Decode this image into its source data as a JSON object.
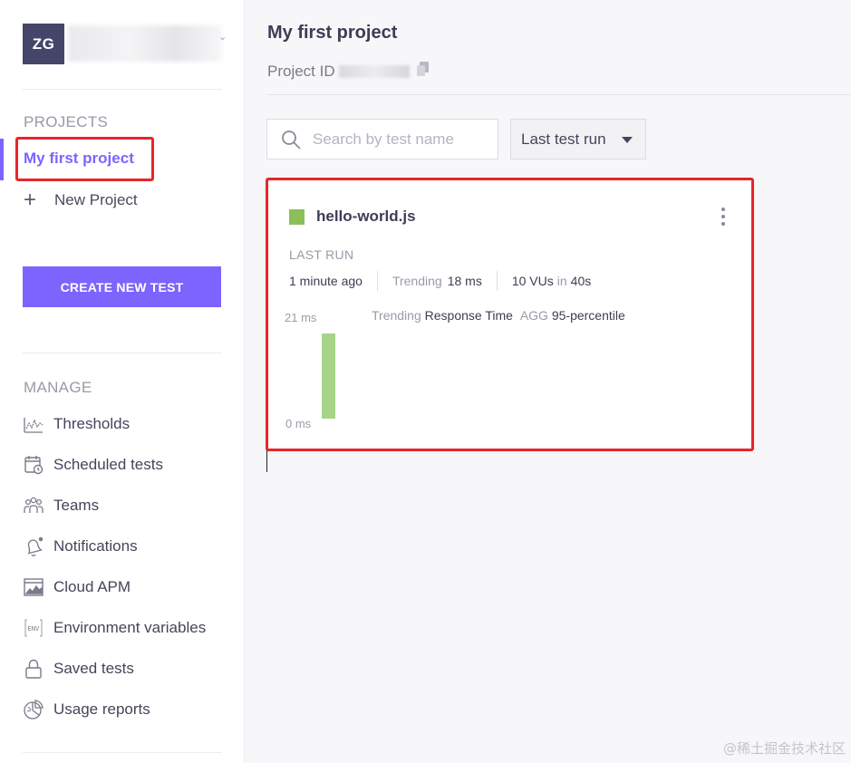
{
  "user": {
    "initials": "ZG"
  },
  "sidebar": {
    "projects_heading": "PROJECTS",
    "active_project": "My first project",
    "new_project_label": "New Project",
    "create_button": "CREATE NEW TEST",
    "manage_heading": "MANAGE",
    "manage_items": [
      {
        "label": "Thresholds",
        "icon": "thresholds-icon"
      },
      {
        "label": "Scheduled tests",
        "icon": "calendar-clock-icon"
      },
      {
        "label": "Teams",
        "icon": "people-icon"
      },
      {
        "label": "Notifications",
        "icon": "bell-icon"
      },
      {
        "label": "Cloud APM",
        "icon": "chart-window-icon"
      },
      {
        "label": "Environment variables",
        "icon": "env-icon"
      },
      {
        "label": "Saved tests",
        "icon": "lock-icon"
      },
      {
        "label": "Usage reports",
        "icon": "pie-chart-icon"
      }
    ]
  },
  "main": {
    "title": "My first project",
    "project_id_label": "Project ID",
    "search_placeholder": "Search by test name",
    "sort_value": "Last test run",
    "test_card": {
      "name": "hello-world.js",
      "status_color": "#8cbf5a",
      "last_run_label": "LAST RUN",
      "last_run_value": "1 minute ago",
      "trending_label": "Trending",
      "trending_value": "18 ms",
      "vus_value": "10 VUs",
      "vus_in": "in",
      "duration_value": "40s",
      "chart": {
        "y_max_label": "21 ms",
        "y_min_label": "0 ms",
        "legend_trending": "Trending",
        "legend_metric": "Response Time",
        "legend_agg": "AGG",
        "legend_percentile": "95-percentile"
      }
    }
  },
  "watermark": "@稀土掘金技术社区",
  "colors": {
    "accent": "#7d64ff",
    "highlight": "#e8252a",
    "bar": "#a8d48a"
  },
  "chart_data": {
    "type": "bar",
    "categories": [
      ""
    ],
    "values": [
      18
    ],
    "ylim": [
      0,
      21
    ],
    "title": "",
    "xlabel": "",
    "ylabel": ""
  }
}
